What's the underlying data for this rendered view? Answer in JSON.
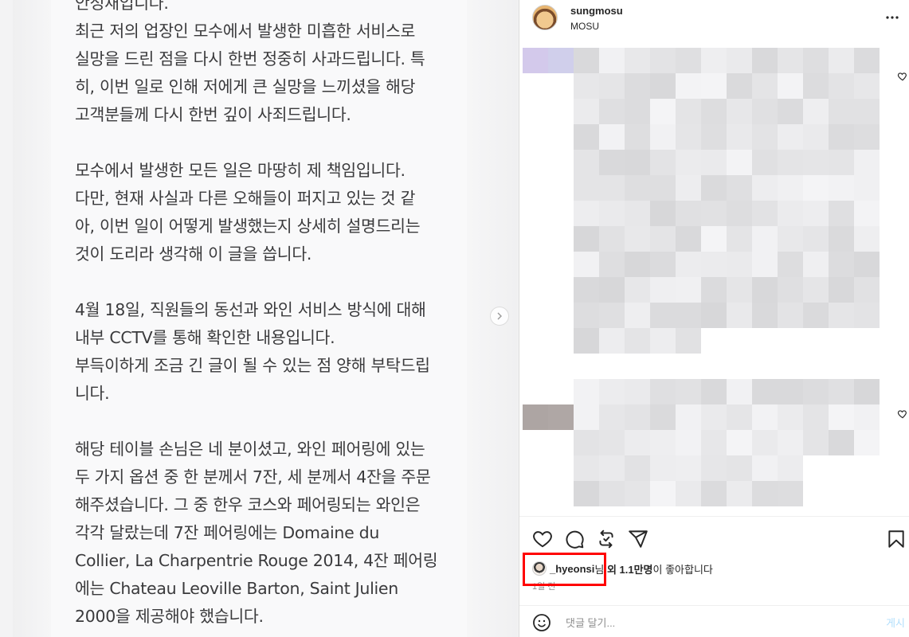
{
  "post_image": {
    "lines": [
      "안성재입니다.",
      "최근 저의 업장인 모수에서 발생한 미흡한 서비스로",
      "실망을 드린 점을 다시 한번 정중히 사과드립니다. 특",
      "히, 이번 일로 인해 저에게 큰 실망을 느끼셨을 해당",
      "고객분들께 다시 한번 깊이 사죄드립니다.",
      "",
      "모수에서 발생한 모든 일은 마땅히 제 책임입니다.",
      "다만, 현재 사실과 다른 오해들이 퍼지고 있는 것 같",
      "아, 이번 일이 어떻게 발생했는지 상세히 설명드리는",
      "것이 도리라 생각해 이 글을 씁니다.",
      "",
      "4월 18일, 직원들의 동선과 와인 서비스 방식에 대해",
      "내부 CCTV를 통해 확인한 내용입니다.",
      "부득이하게 조금 긴 글이 될 수 있는 점 양해 부탁드립",
      "니다.",
      "",
      "해당 테이블 손님은 네 분이셨고, 와인 페어링에 있는",
      "두 가지 옵션 중 한 분께서 7잔, 세 분께서 4잔을 주문",
      "해주셨습니다. 그 중 한우 코스와 페어링되는 와인은",
      "각각 달랐는데 7잔 페어링에는 Domaine du",
      "Collier, La Charpentrie Rouge 2014, 4잔 페어링",
      "에는 Chateau Leoville Barton, Saint Julien",
      "2000을 제공해야 했습니다."
    ],
    "next_icon": "chevron-right-icon"
  },
  "author": {
    "username": "sungmosu",
    "subtitle": "MOSU",
    "avatar_icon": "profile-avatar",
    "more_icon": "more-horizontal-icon"
  },
  "comments_area": {
    "blurred": true,
    "heart_icon": "heart-outline-icon"
  },
  "actions": {
    "icons": [
      "heart-icon",
      "comment-icon",
      "repost-icon",
      "share-icon",
      "bookmark-icon"
    ]
  },
  "likes": {
    "liker_name": "_hyeonsi",
    "suffix_honorific": "님",
    "and_others": " 외 ",
    "count": "1.1만명",
    "tail": "이 좋아합니다"
  },
  "time_ago": "1일 전",
  "comment_box": {
    "placeholder": "댓글 달기...",
    "post_label": "게시",
    "emoji_icon": "smiley-icon"
  },
  "colors": {
    "highlight": "#ff0000",
    "post_button": "#b2dffc",
    "text_secondary": "#8e8e8e"
  }
}
